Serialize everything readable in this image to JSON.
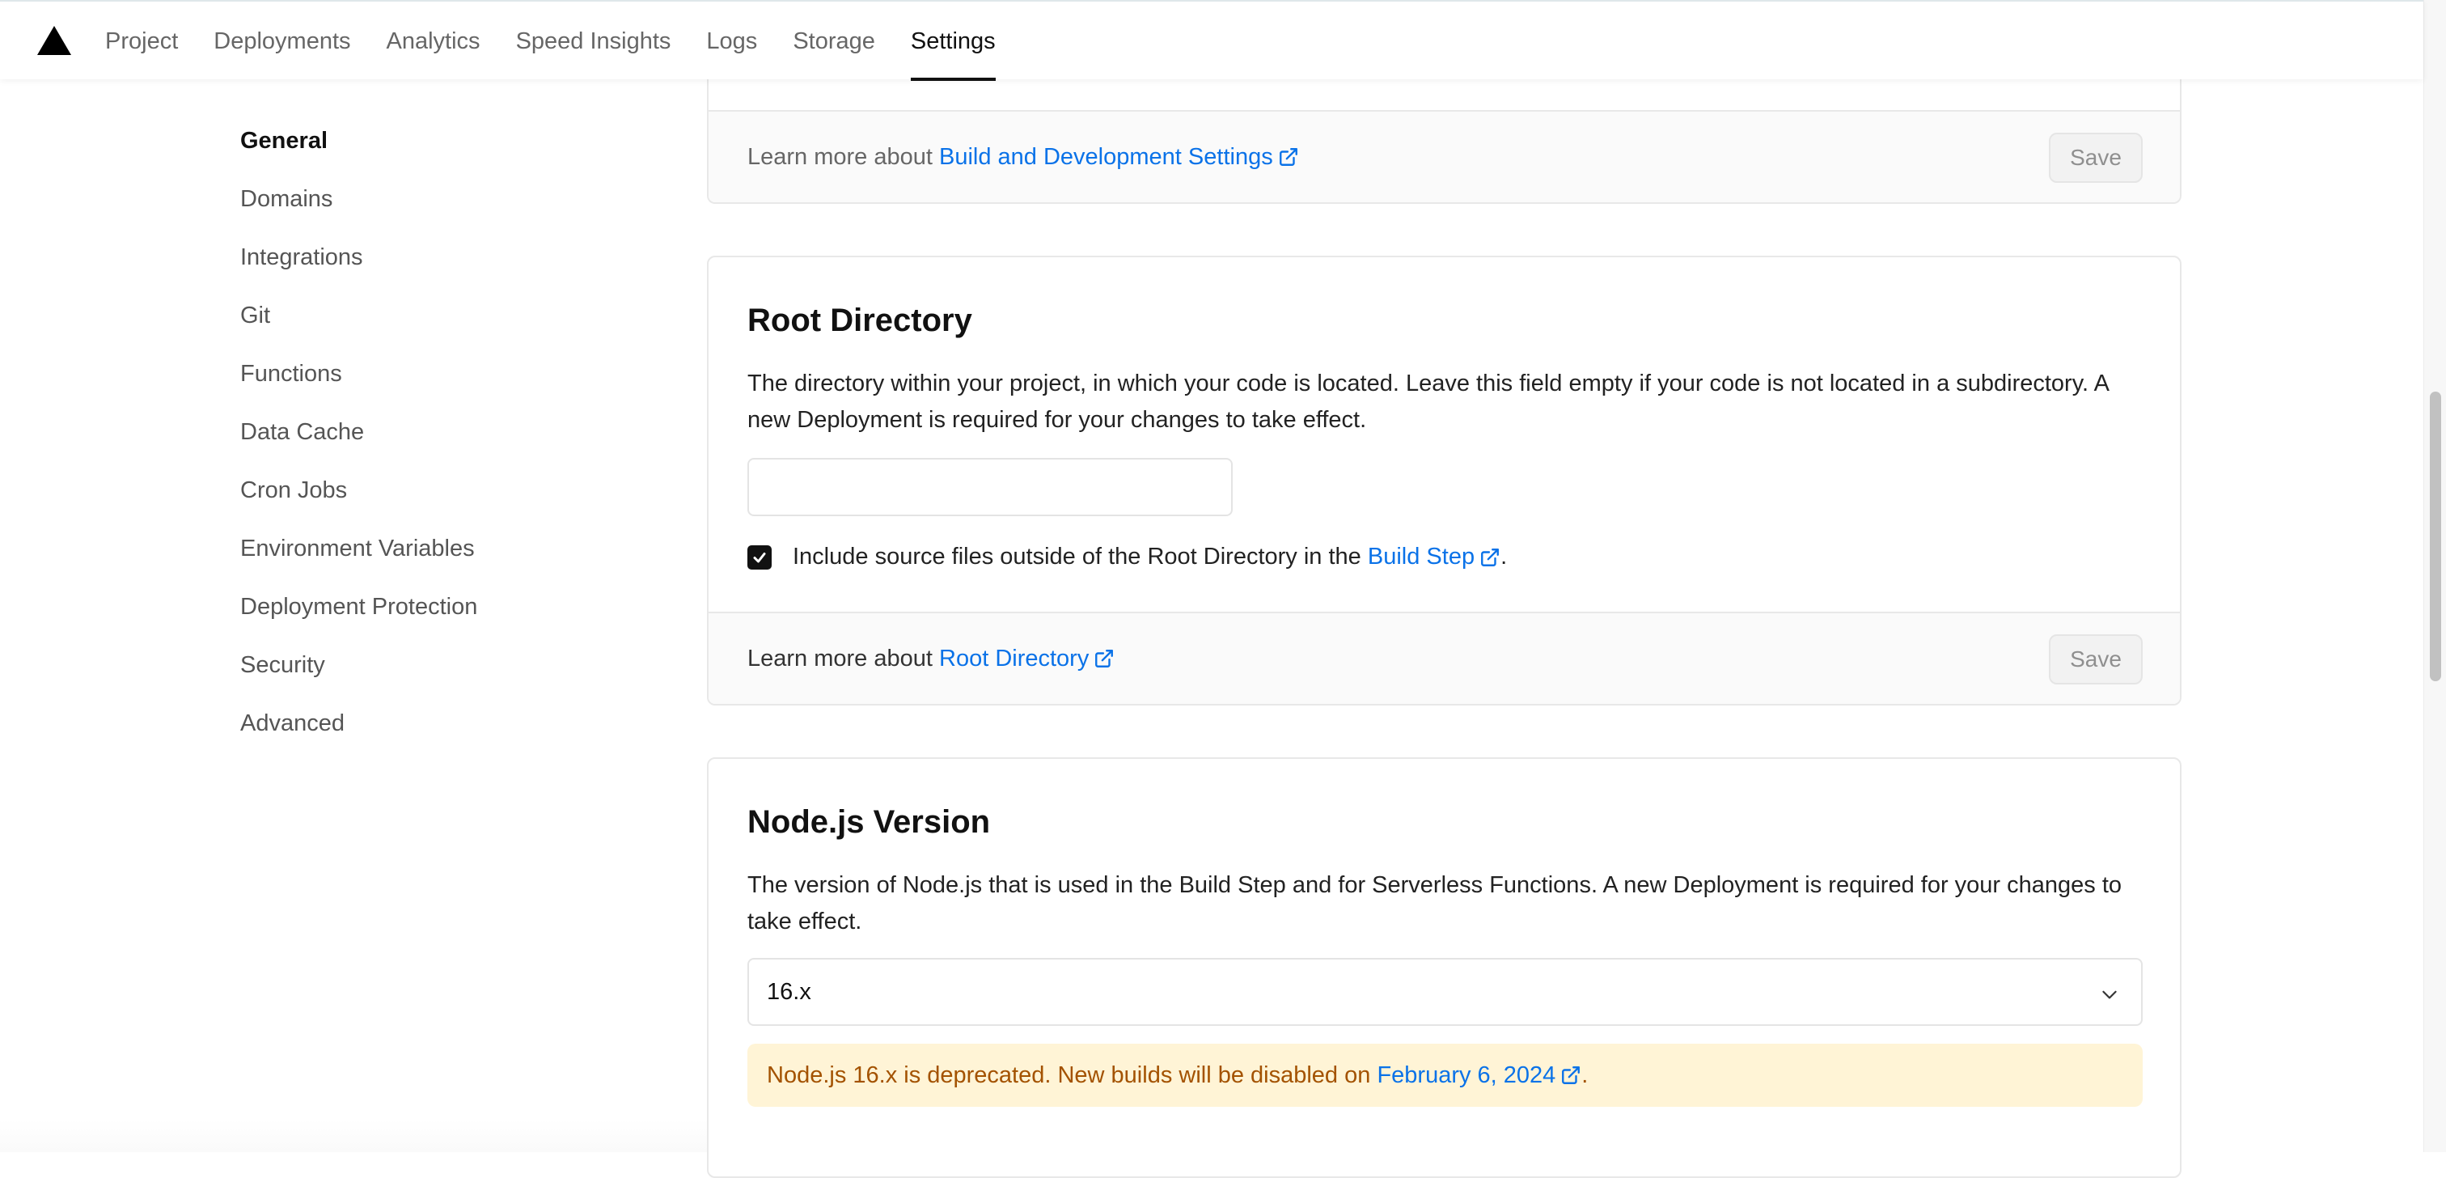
{
  "nav": {
    "tabs": [
      {
        "label": "Project"
      },
      {
        "label": "Deployments"
      },
      {
        "label": "Analytics"
      },
      {
        "label": "Speed Insights"
      },
      {
        "label": "Logs"
      },
      {
        "label": "Storage"
      },
      {
        "label": "Settings",
        "active": true
      }
    ]
  },
  "sidebar": {
    "items": [
      {
        "label": "General",
        "active": true
      },
      {
        "label": "Domains"
      },
      {
        "label": "Integrations"
      },
      {
        "label": "Git"
      },
      {
        "label": "Functions"
      },
      {
        "label": "Data Cache"
      },
      {
        "label": "Cron Jobs"
      },
      {
        "label": "Environment Variables"
      },
      {
        "label": "Deployment Protection"
      },
      {
        "label": "Security"
      },
      {
        "label": "Advanced"
      }
    ]
  },
  "build_settings": {
    "learn_prefix": "Learn more about",
    "learn_link": "Build and Development Settings",
    "save_label": "Save"
  },
  "root_directory": {
    "title": "Root Directory",
    "description": "The directory within your project, in which your code is located. Leave this field empty if your code is not located in a subdirectory. A new Deployment is required for your changes to take effect.",
    "input_value": "",
    "include_checked": true,
    "include_text": "Include source files outside of the Root Directory in the",
    "include_link": "Build Step",
    "include_suffix": ".",
    "learn_prefix": "Learn more about",
    "learn_link": "Root Directory",
    "save_label": "Save"
  },
  "node_version": {
    "title": "Node.js Version",
    "description": "The version of Node.js that is used in the Build Step and for Serverless Functions. A new Deployment is required for your changes to take effect.",
    "selected": "16.x",
    "warning_text": "Node.js 16.x is deprecated. New builds will be disabled on",
    "warning_link": "February 6, 2024",
    "warning_suffix": "."
  },
  "colors": {
    "link": "#0a72e8",
    "warning_bg": "#fff4d6",
    "warning_text": "#a35200"
  }
}
